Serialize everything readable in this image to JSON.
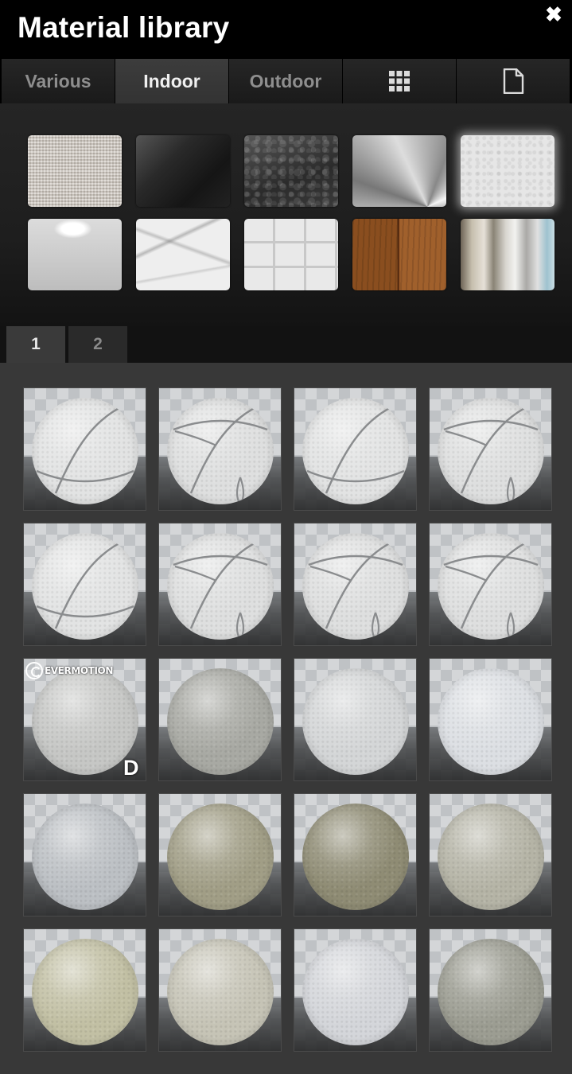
{
  "window": {
    "title": "Material library",
    "close_glyph": "✖"
  },
  "tabs": [
    {
      "label": "Various",
      "active": false
    },
    {
      "label": "Indoor",
      "active": true
    },
    {
      "label": "Outdoor",
      "active": false
    },
    {
      "icon": "grid-icon"
    },
    {
      "icon": "document-icon"
    }
  ],
  "categories": [
    {
      "name": "fabric",
      "selected": false
    },
    {
      "name": "glossy-black",
      "selected": false
    },
    {
      "name": "leather",
      "selected": false
    },
    {
      "name": "brushed-steel",
      "selected": false
    },
    {
      "name": "plaster",
      "selected": true
    },
    {
      "name": "glossy-white",
      "selected": false
    },
    {
      "name": "marble",
      "selected": false
    },
    {
      "name": "tiles",
      "selected": false
    },
    {
      "name": "wood",
      "selected": false
    },
    {
      "name": "curtain",
      "selected": false
    }
  ],
  "pages": [
    {
      "label": "1",
      "active": true
    },
    {
      "label": "2",
      "active": false
    }
  ],
  "brand_text": "EVERMOTION",
  "badge_letter": "D",
  "materials": [
    {
      "color": "#e2e3e3",
      "seams": "a"
    },
    {
      "color": "#dedfdf",
      "seams": "b"
    },
    {
      "color": "#e2e3e3",
      "seams": "a"
    },
    {
      "color": "#dedfdf",
      "seams": "b"
    },
    {
      "color": "#e2e3e3",
      "seams": "a"
    },
    {
      "color": "#dedfdf",
      "seams": "b"
    },
    {
      "color": "#dedfdf",
      "seams": "b"
    },
    {
      "color": "#dedfdf",
      "seams": "b"
    },
    {
      "color": "#c6c7c5",
      "brand": true,
      "letter": true
    },
    {
      "color": "#a8a9a3"
    },
    {
      "color": "#d4d6d7"
    },
    {
      "color": "#dcdfe3"
    },
    {
      "color": "#bcc0c4"
    },
    {
      "color": "#a19e86"
    },
    {
      "color": "#8f8c74"
    },
    {
      "color": "#b5b4a6"
    },
    {
      "color": "#c2c0a4"
    },
    {
      "color": "#c6c4b6"
    },
    {
      "color": "#d4d6da"
    },
    {
      "color": "#9c9d92"
    }
  ]
}
